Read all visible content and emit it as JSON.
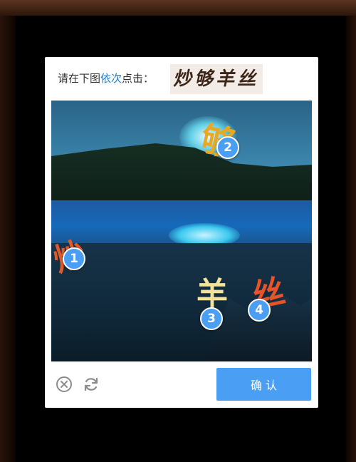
{
  "captcha": {
    "prompt_prefix": "请在下图",
    "prompt_highlight": "依次",
    "prompt_suffix": "点击：",
    "target_chars": [
      "炒",
      "够",
      "羊",
      "丝"
    ],
    "highlight_color": "#1e7ed6",
    "accent_color": "#4a9ff5",
    "markers": [
      "1",
      "2",
      "3",
      "4"
    ],
    "confirm_label": "确 认",
    "close_icon": "close-circle-icon",
    "refresh_icon": "refresh-icon"
  }
}
